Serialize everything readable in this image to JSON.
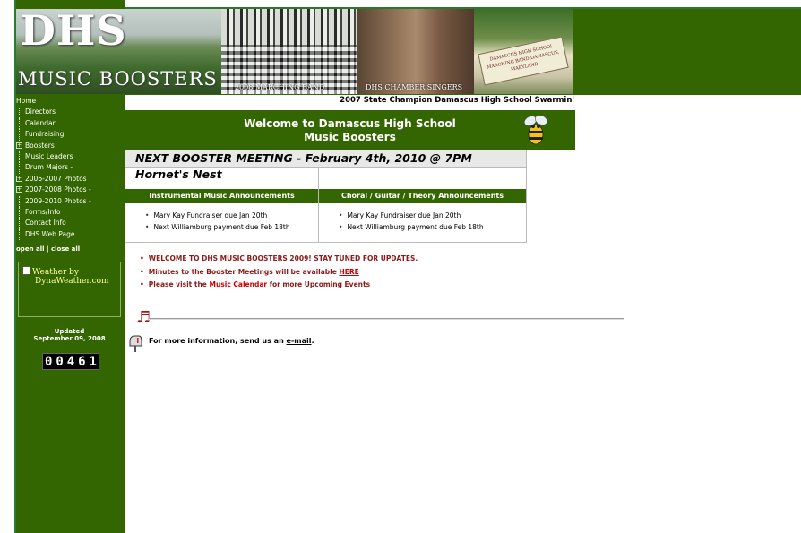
{
  "banner": {
    "logo_top": "DHS",
    "logo_bottom": "MUSIC BOOSTERS",
    "caption_marching": "2008 MARCHING BAND",
    "caption_chamber": "DHS CHAMBER SINGERS",
    "sign_text": "DAMASCUS HIGH SCHOOL MARCHING BAND DAMASCUS, MARYLAND"
  },
  "sidebar": {
    "home": "Home",
    "items": [
      {
        "label": "Directors",
        "expandable": false
      },
      {
        "label": "Calendar",
        "expandable": false
      },
      {
        "label": "Fundraising",
        "expandable": false
      },
      {
        "label": "Boosters",
        "expandable": true
      },
      {
        "label": "Music Leaders",
        "expandable": false
      },
      {
        "label": "Drum Majors -",
        "expandable": false
      },
      {
        "label": "2006-2007 Photos",
        "expandable": true
      },
      {
        "label": "2007-2008 Photos -",
        "expandable": true
      },
      {
        "label": "2009-2010 Photos -",
        "expandable": false
      },
      {
        "label": "Forms/Info",
        "expandable": false
      },
      {
        "label": "Contact Info",
        "expandable": false
      },
      {
        "label": "DHS Web Page",
        "expandable": false
      }
    ],
    "open_all": "open all",
    "separator": "|",
    "close_all": "close all",
    "weather_line1": "Weather by",
    "weather_line2": "DynaWeather.com",
    "updated_label": "Updated",
    "updated_date": "September 09, 2008",
    "counter_digits": [
      "0",
      "0",
      "4",
      "6",
      "1"
    ]
  },
  "ticker": "2007 State Champion Damascus High School Swarmin'",
  "welcome": {
    "line1": "Welcome to Damascus High School",
    "line2": "Music Boosters"
  },
  "meeting": "NEXT BOOSTER MEETING - February 4th, 2010 @ 7PM Hornet's Nest",
  "announcements": {
    "instrumental_header": "Instrumental Music Announcements",
    "choral_header": "Choral / Guitar / Theory Announcements",
    "instrumental_items": [
      "Mary Kay Fundraiser due Jan 20th",
      "Next Williamburg payment due Feb 18th"
    ],
    "choral_items": [
      "Mary Kay Fundraiser due Jan 20th",
      "Next Williamburg payment due Feb 18th"
    ]
  },
  "news": {
    "item1": "WELCOME TO  DHS MUSIC BOOSTERS 2009!  STAY TUNED FOR UPDATES.",
    "item2_pre": "Minutes to the Booster Meetings will be available ",
    "item2_link": "HERE",
    "item3_pre": "Please visit the ",
    "item3_link": "Music Calendar ",
    "item3_post": "for more Upcoming Events"
  },
  "contact": {
    "text": "For more information, send us an ",
    "link": "e-mail",
    "suffix": "."
  },
  "colors": {
    "green": "#336600",
    "dark_red": "#8b1a1a"
  }
}
